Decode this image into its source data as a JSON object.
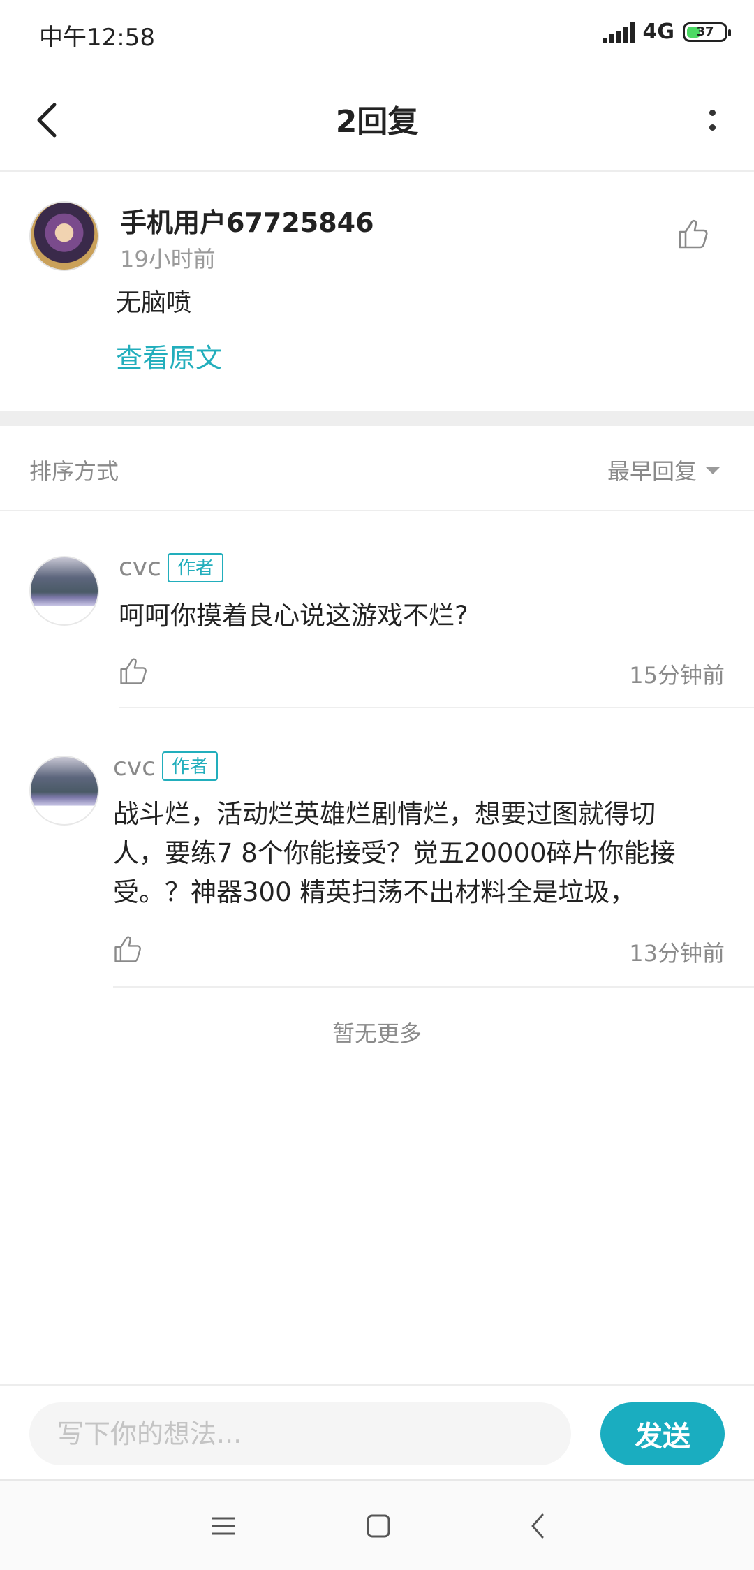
{
  "status_bar": {
    "time": "中午12:58",
    "network": "4G",
    "battery": "37",
    "battery_percent": 37,
    "battery_color": "#4cd964"
  },
  "header": {
    "title": "2回复",
    "back_icon": "chevron-left-icon",
    "more_icon": "more-vertical-icon"
  },
  "original_comment": {
    "username": "手机用户67725846",
    "time": "19小时前",
    "text": "无脑喷",
    "view_original_label": "查看原文",
    "like_icon": "thumbs-up-icon"
  },
  "sort": {
    "label": "排序方式",
    "value": "最早回复"
  },
  "replies": [
    {
      "username": "cvc",
      "badge": "作者",
      "text": "呵呵你摸着良心说这游戏不烂?",
      "time": "15分钟前"
    },
    {
      "username": "cvc",
      "badge": "作者",
      "text": "战斗烂，活动烂英雄烂剧情烂，想要过图就得切人，要练7 8个你能接受？觉五20000碎片你能接受。？神器300 精英扫荡不出材料全是垃圾，",
      "time": "13分钟前"
    }
  ],
  "no_more": "暂无更多",
  "input_bar": {
    "placeholder": "写下你的想法...",
    "send_label": "发送"
  },
  "colors": {
    "accent": "#1aadc0",
    "link": "#22aebc",
    "muted": "#8a8a8a"
  },
  "nav_bar": {
    "icons": [
      "menu-icon",
      "home-square-icon",
      "back-triangle-icon"
    ]
  }
}
